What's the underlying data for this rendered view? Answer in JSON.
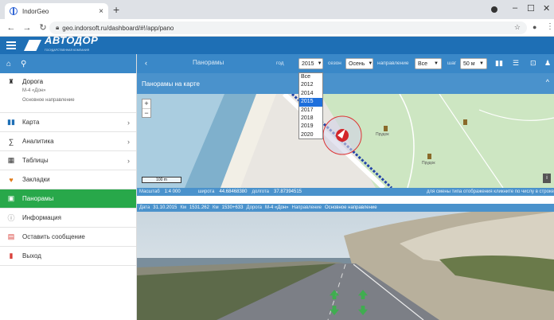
{
  "browser": {
    "tab_title": "IndorGeo",
    "url": "geo.indorsoft.ru/dashboard/#!/app/pano",
    "min_label": "–",
    "max_label": "☐",
    "close_label": "✕"
  },
  "app": {
    "logo_text": "АВТОДОР",
    "logo_sub": "ГОСУДАРСТВЕННАЯ КОМПАНИЯ"
  },
  "sidebar": {
    "road_label": "Дорога",
    "road_name": "М-4 «Дон»",
    "road_direction": "Основное направление",
    "items": [
      {
        "label": "Карта",
        "icon": "map-icon"
      },
      {
        "label": "Аналитика",
        "icon": "sum-icon"
      },
      {
        "label": "Таблицы",
        "icon": "table-icon"
      },
      {
        "label": "Закладки",
        "icon": "bookmark-icon"
      },
      {
        "label": "Панорамы",
        "icon": "panorama-icon"
      },
      {
        "label": "Информация",
        "icon": "info-icon"
      },
      {
        "label": "Оставить сообщение",
        "icon": "message-icon"
      },
      {
        "label": "Выход",
        "icon": "exit-icon"
      }
    ]
  },
  "toolbar": {
    "title": "Панорамы",
    "year_label": "год",
    "year_value": "2015",
    "season_label": "сезон",
    "season_value": "Осень",
    "direction_label": "направление",
    "direction_value": "Все",
    "step_label": "шаг",
    "step_value": "50 м",
    "year_options": [
      "Все",
      "2012",
      "2014",
      "2015",
      "2017",
      "2018",
      "2019",
      "2020"
    ],
    "year_selected_index": 3
  },
  "map": {
    "header": "Панорамы на карте",
    "zoom_in": "+",
    "zoom_out": "−",
    "scale_text": "100 m",
    "place_label": "Прудок",
    "status": {
      "scale_label": "Масштаб",
      "scale_value": "1:4 000",
      "lat_label": "широта",
      "lat_value": "44.68468380",
      "lon_label": "долгота",
      "lon_value": "37.87394515",
      "hint": "для смены типа отображения кликните по числу в строке"
    }
  },
  "pano": {
    "date_label": "Дата",
    "date_value": "31.10.2015",
    "km_label": "Км",
    "km_value": "1531.262",
    "km2_label": "Км",
    "km2_value": "1530+633",
    "road_label": "Дорога",
    "road_value": "М-4 «Дон»",
    "dir_label": "Направление",
    "dir_value": "Основное направление"
  },
  "colors": {
    "header_blue": "#1e6fb5",
    "toolbar_blue": "#3a88c8",
    "active_green": "#28a84a"
  }
}
